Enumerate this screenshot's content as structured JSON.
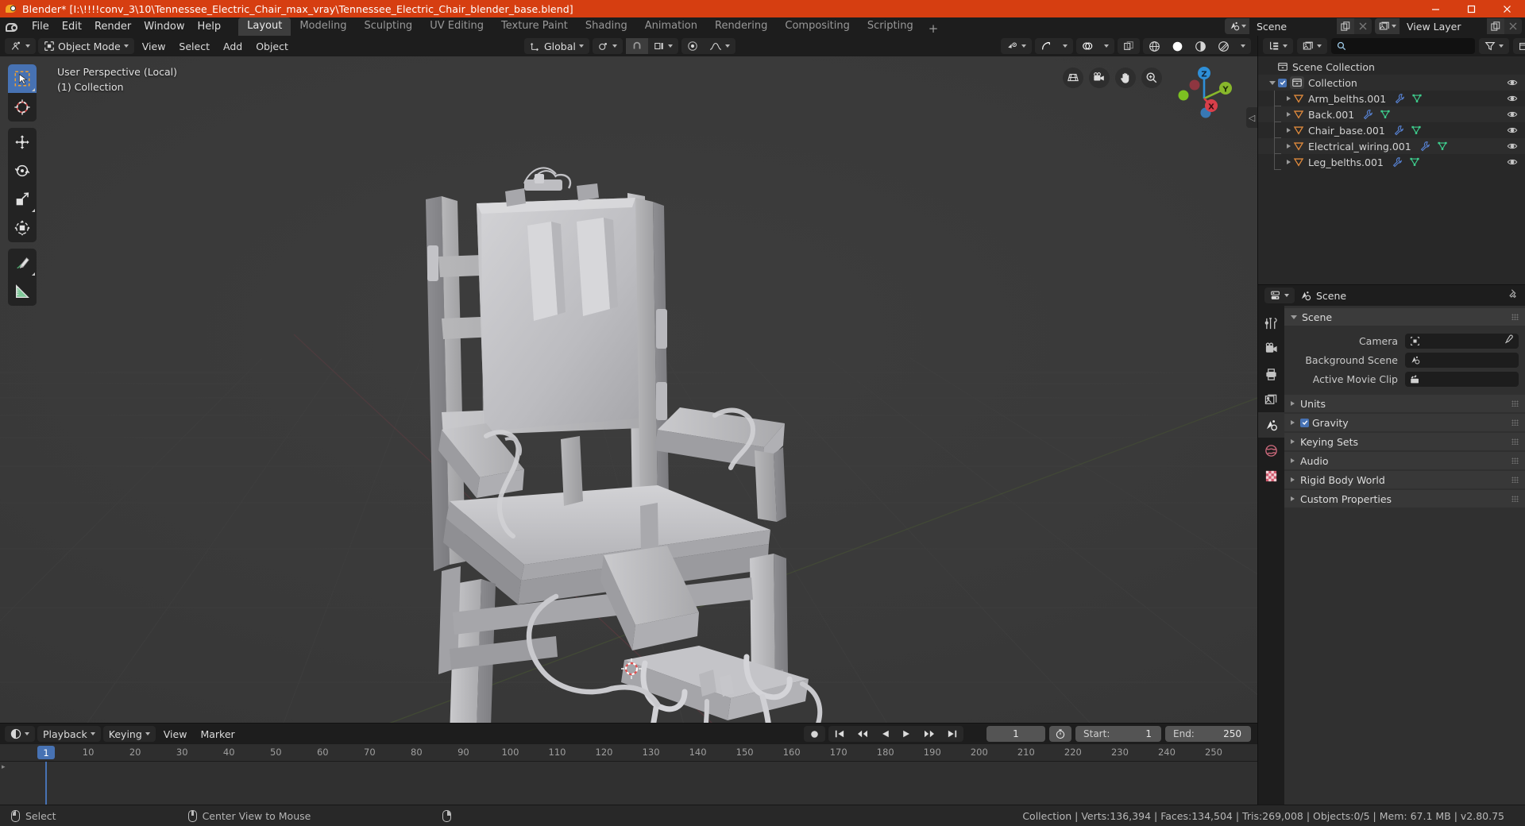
{
  "window": {
    "title": "Blender* [I:\\!!!!conv_3\\10\\Tennessee_Electric_Chair_max_vray\\Tennessee_Electric_Chair_blender_base.blend]",
    "minimize": "–",
    "maximize": "□",
    "close": "✕"
  },
  "topbar": {
    "menus": [
      "File",
      "Edit",
      "Render",
      "Window",
      "Help"
    ],
    "workspaces": [
      {
        "label": "Layout",
        "active": true
      },
      {
        "label": "Modeling",
        "active": false
      },
      {
        "label": "Sculpting",
        "active": false
      },
      {
        "label": "UV Editing",
        "active": false
      },
      {
        "label": "Texture Paint",
        "active": false
      },
      {
        "label": "Shading",
        "active": false
      },
      {
        "label": "Animation",
        "active": false
      },
      {
        "label": "Rendering",
        "active": false
      },
      {
        "label": "Compositing",
        "active": false
      },
      {
        "label": "Scripting",
        "active": false
      }
    ],
    "add_workspace": "+",
    "scene_name": "Scene",
    "view_layer_name": "View Layer"
  },
  "viewport": {
    "header": {
      "mode": "Object Mode",
      "menus": [
        "View",
        "Select",
        "Add",
        "Object"
      ],
      "transform_orientation": "Global"
    },
    "overlay": {
      "perspective": "User Perspective (Local)",
      "collection": "(1) Collection"
    },
    "gizmo": {
      "axis_x": "X",
      "axis_y": "Y",
      "axis_z": "Z"
    },
    "tools": [
      {
        "name": "select-box-tool",
        "active": true
      },
      {
        "name": "cursor-tool",
        "active": false
      },
      {
        "name": "move-tool",
        "active": false
      },
      {
        "name": "rotate-tool",
        "active": false
      },
      {
        "name": "scale-tool",
        "active": false
      },
      {
        "name": "transform-tool",
        "active": false
      },
      {
        "name": "annotate-tool",
        "active": false
      },
      {
        "name": "measure-tool",
        "active": false
      }
    ],
    "nav_buttons": [
      "grid-ortho-icon",
      "camera-view-icon",
      "pan-hand-icon",
      "zoom-magnifier-icon"
    ]
  },
  "timeline": {
    "editor_menus": [
      "Playback",
      "Keying",
      "View",
      "Marker"
    ],
    "playback_label": "Playback",
    "keying_label": "Keying",
    "view_label": "View",
    "marker_label": "Marker",
    "current_frame": "1",
    "start_label": "Start:",
    "start_value": "1",
    "end_label": "End:",
    "end_value": "250",
    "ticks": [
      "10",
      "20",
      "30",
      "40",
      "50",
      "60",
      "70",
      "80",
      "90",
      "100",
      "110",
      "120",
      "130",
      "140",
      "150",
      "160",
      "170",
      "180",
      "190",
      "200",
      "210",
      "220",
      "230",
      "240",
      "250"
    ],
    "playhead_label": "1"
  },
  "outliner": {
    "search_placeholder": "",
    "root": "Scene Collection",
    "collection": "Collection",
    "objects": [
      {
        "name": "Arm_belths.001"
      },
      {
        "name": "Back.001"
      },
      {
        "name": "Chair_base.001"
      },
      {
        "name": "Electrical_wiring.001"
      },
      {
        "name": "Leg_belths.001"
      }
    ]
  },
  "properties": {
    "breadcrumb": "Scene",
    "panel_title": "Scene",
    "rows": [
      {
        "label": "Camera",
        "value": ""
      },
      {
        "label": "Background Scene",
        "value": ""
      },
      {
        "label": "Active Movie Clip",
        "value": ""
      }
    ],
    "sections": [
      {
        "label": "Units",
        "checkbox": false
      },
      {
        "label": "Gravity",
        "checkbox": true
      },
      {
        "label": "Keying Sets",
        "checkbox": false
      },
      {
        "label": "Audio",
        "checkbox": false
      },
      {
        "label": "Rigid Body World",
        "checkbox": false
      },
      {
        "label": "Custom Properties",
        "checkbox": false
      }
    ]
  },
  "statusbar": {
    "left_action": "Select",
    "middle_action": "Center View to Mouse",
    "stats": "Collection | Verts:136,394 | Faces:134,504 | Tris:269,008 | Objects:0/5 | Mem: 67.1 MB | v2.80.75"
  },
  "colors": {
    "accent": "#4772b3",
    "title_bar": "#d63e11",
    "mesh_icon": "#e08a3c",
    "modifier_icon": "#5680d0",
    "data_icon": "#3ecf8e"
  }
}
